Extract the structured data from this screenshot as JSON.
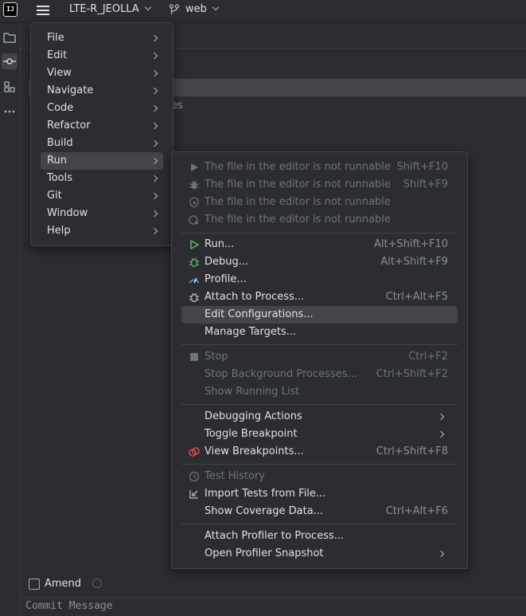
{
  "titlebar": {
    "logo_text": "IJ",
    "project_name": "LTE-R_JEOLLA",
    "branch": "web"
  },
  "left_strip": {
    "icons": [
      "folder-icon",
      "commit-icon",
      "structure-icon",
      "more-icon"
    ]
  },
  "background": {
    "partial_text": "es"
  },
  "main_menu": {
    "items": [
      {
        "label": "File"
      },
      {
        "label": "Edit"
      },
      {
        "label": "View"
      },
      {
        "label": "Navigate"
      },
      {
        "label": "Code"
      },
      {
        "label": "Refactor"
      },
      {
        "label": "Build"
      },
      {
        "label": "Run",
        "highlighted": true
      },
      {
        "label": "Tools"
      },
      {
        "label": "Git"
      },
      {
        "label": "Window"
      },
      {
        "label": "Help"
      }
    ]
  },
  "run_menu": {
    "items": [
      {
        "label": "The file in the editor is not runnable",
        "shortcut": "Shift+F10",
        "disabled": true,
        "icon": "run-icon"
      },
      {
        "label": "The file in the editor is not runnable",
        "shortcut": "Shift+F9",
        "disabled": true,
        "icon": "debug-icon"
      },
      {
        "label": "The file in the editor is not runnable",
        "shortcut": "",
        "disabled": true,
        "icon": "coverage-icon"
      },
      {
        "label": "The file in the editor is not runnable",
        "shortcut": "",
        "disabled": true,
        "icon": "profile-run-icon"
      },
      {
        "label": "Run...",
        "shortcut": "Alt+Shift+F10",
        "icon": "run-icon"
      },
      {
        "label": "Debug...",
        "shortcut": "Alt+Shift+F9",
        "icon": "debug-icon"
      },
      {
        "label": "Profile...",
        "shortcut": "",
        "icon": "profile-icon"
      },
      {
        "label": "Attach to Process...",
        "shortcut": "Ctrl+Alt+F5",
        "icon": "attach-icon"
      },
      {
        "label": "Edit Configurations...",
        "shortcut": "",
        "highlighted": true
      },
      {
        "label": "Manage Targets...",
        "shortcut": ""
      },
      {
        "label": "Stop",
        "shortcut": "Ctrl+F2",
        "disabled": true,
        "icon": "stop-icon"
      },
      {
        "label": "Stop Background Processes...",
        "shortcut": "Ctrl+Shift+F2",
        "disabled": true
      },
      {
        "label": "Show Running List",
        "shortcut": "",
        "disabled": true
      },
      {
        "label": "Debugging Actions",
        "submenu": true
      },
      {
        "label": "Toggle Breakpoint",
        "submenu": true
      },
      {
        "label": "View Breakpoints...",
        "shortcut": "Ctrl+Shift+F8",
        "icon": "breakpoints-icon"
      },
      {
        "label": "Test History",
        "shortcut": "",
        "disabled": true,
        "icon": "history-icon"
      },
      {
        "label": "Import Tests from File...",
        "shortcut": "",
        "icon": "import-icon"
      },
      {
        "label": "Show Coverage Data...",
        "shortcut": "Ctrl+Alt+F6"
      },
      {
        "label": "Attach Profiler to Process...",
        "shortcut": ""
      },
      {
        "label": "Open Profiler Snapshot",
        "submenu": true
      }
    ]
  },
  "commit_panel": {
    "amend_label": "Amend",
    "commit_placeholder": "Commit Message"
  },
  "colors": {
    "background": "#2b2d30",
    "highlight": "#43454a",
    "run_green": "#5fb865",
    "profile_blue": "#3d8ad6",
    "breakpoint_red": "#e5493f"
  }
}
